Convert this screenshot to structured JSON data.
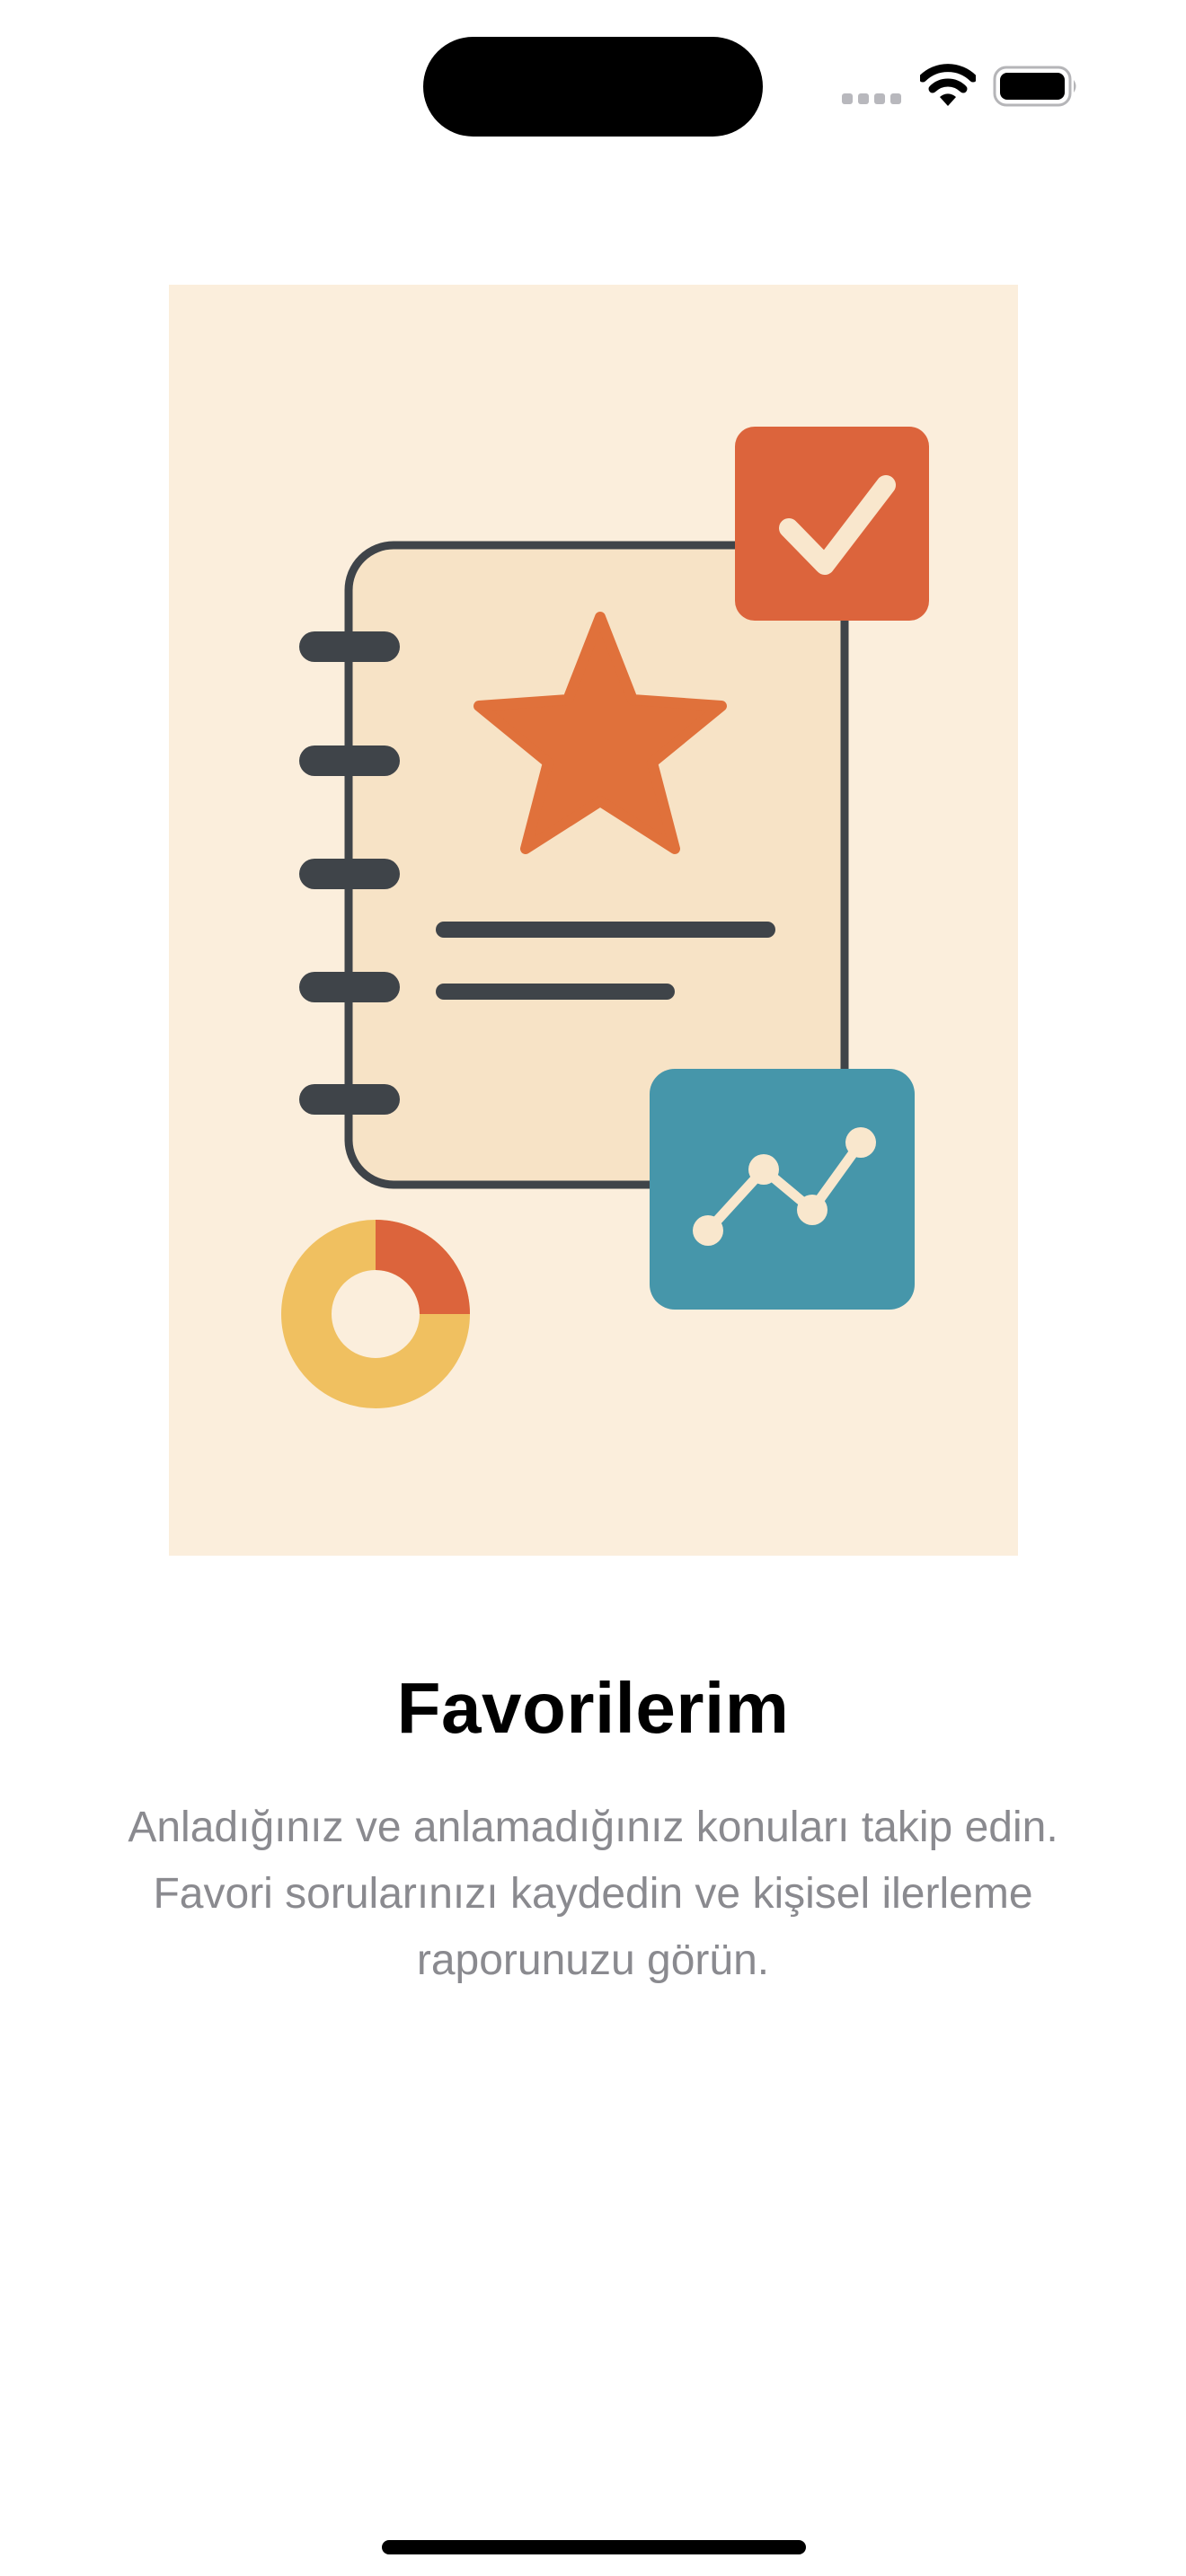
{
  "status_bar": {
    "icons": [
      "signal-icon",
      "wifi-icon",
      "battery-icon"
    ]
  },
  "onboarding": {
    "illustration": {
      "icons": [
        "notebook-icon",
        "star-icon",
        "checkmark-icon",
        "line-chart-icon",
        "donut-chart-icon"
      ],
      "colors": {
        "background": "#FBEEDC",
        "notebook": "#F7E3C6",
        "outline": "#3F4449",
        "star": "#E0713B",
        "check_box": "#DC643C",
        "check_mark": "#F9E7CD",
        "chart_box": "#4696AA",
        "donut_yellow": "#F0C060",
        "donut_red": "#DC643C"
      }
    },
    "title": "Favorilerim",
    "description": "Anladığınız ve anlamadığınız konuları takip edin. Favori sorularınızı kaydedin ve kişisel ilerleme raporunuzu görün."
  }
}
